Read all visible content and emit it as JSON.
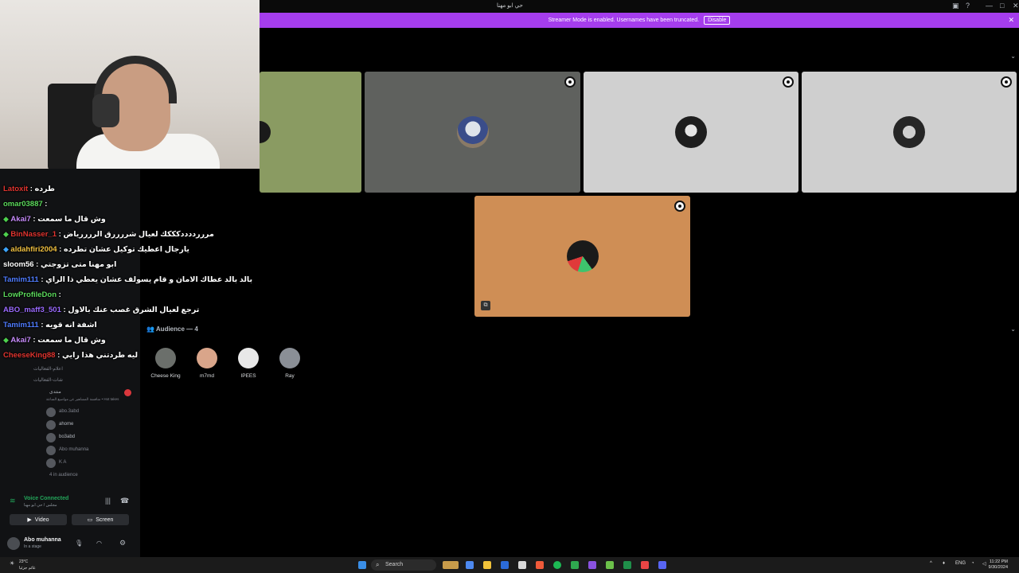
{
  "window": {
    "title": "حي ابو مهنا"
  },
  "banner": {
    "text": "Streamer Mode is enabled. Usernames have been truncated.",
    "disable_label": "Disable",
    "color": "#a53ded"
  },
  "stage": {
    "tiles": [
      {
        "bg": "#8a9b62"
      },
      {
        "bg": "#5f615e"
      },
      {
        "bg": "#d0d0d0"
      },
      {
        "bg": "#cfcfcf"
      },
      {
        "bg": "#cf8e55"
      }
    ]
  },
  "chat": {
    "lines": [
      {
        "user": "Latoxit",
        "color": "#e0342f",
        "msg": "طرده"
      },
      {
        "user": "omar03887",
        "color": "#5bd95b",
        "msg": ""
      },
      {
        "user": "Akai7",
        "color": "#c58af9",
        "msg": "وش قال ما سمعت",
        "gem": "green"
      },
      {
        "user": "BinNasser_1",
        "color": "#e0342f",
        "msg": "مرررددددكككك لعيال شررررق الررررياض",
        "gem": "green"
      },
      {
        "user": "aldahfiri2004",
        "color": "#f0c040",
        "msg": "يارجال اعطيك توكيل عشان تطرده",
        "gem": "blue"
      },
      {
        "user": "sloom56",
        "color": "#ffffff",
        "msg": "ابو مهنا متى تزوجتي"
      },
      {
        "user": "Tamim111",
        "color": "#4f7cff",
        "msg": "بالد بالد عطاك الامان و قام يسولف عشان يعطي ذا الراي"
      },
      {
        "user": "LowProfileDon",
        "color": "#5bd95b",
        "msg": ""
      },
      {
        "user": "ABO_maff3_501",
        "color": "#9b6bff",
        "msg": "ترجع لعيال الشرق غصب عنك بالاول"
      },
      {
        "user": "Tamim111",
        "color": "#4f7cff",
        "msg": "اشفة انه قويه"
      },
      {
        "user": "Akai7",
        "color": "#c58af9",
        "msg": "وش قال ما سمعت",
        "gem": "green"
      },
      {
        "user": "CheeseKing88",
        "color": "#e0342f",
        "msg": "ليه طردتني هذا رايي"
      }
    ]
  },
  "sidebar": {
    "channels": [
      {
        "label": "شات-الادارة"
      },
      {
        "label": "اعلام-الفعاليات"
      },
      {
        "label": "شات-الفعاليات"
      },
      {
        "label": "منتدى"
      },
      {
        "label": "مناقشة المشاهير عن مواضيع الساعة • Hot takes"
      }
    ],
    "members": [
      {
        "name": "abo.3abd"
      },
      {
        "name": "ahome"
      },
      {
        "name": "bo3abd"
      },
      {
        "name": "Abo muhanna"
      },
      {
        "name": "K A"
      }
    ],
    "audience_count_label": "4 in audience",
    "voice_connected": "Voice Connected",
    "voice_channel": "مجلس / حي ابو مهنا",
    "video_label": "Video",
    "screen_label": "Screen",
    "user_name": "Abo muhanna",
    "user_status": "In a stage"
  },
  "audience": {
    "header": "Audience — 4",
    "members": [
      {
        "name": "Cheese King",
        "color": "#6b6f6b"
      },
      {
        "name": "m7md",
        "color": "#d9a58a"
      },
      {
        "name": "IPEES",
        "color": "#e8e8e8"
      },
      {
        "name": "Ray",
        "color": "#8a8f96"
      }
    ]
  },
  "taskbar": {
    "search_label": "Search",
    "weather_temp": "23°C",
    "weather_desc": "غائم جزئيا",
    "lang": "ENG",
    "time": "11:22 PM",
    "date": "9/30/2024"
  }
}
